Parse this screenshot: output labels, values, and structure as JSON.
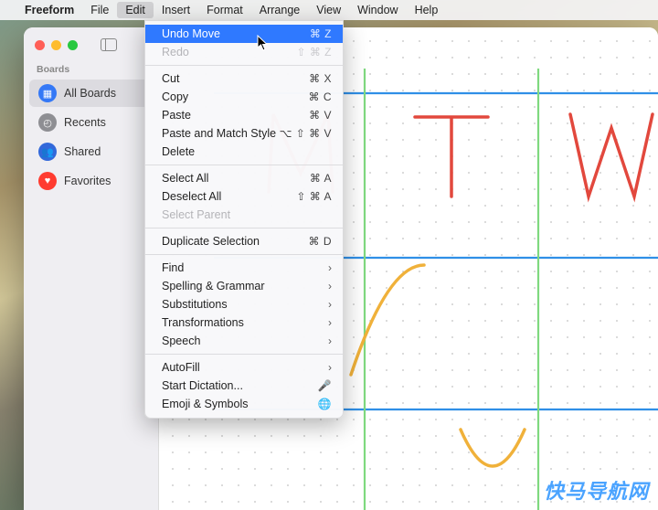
{
  "menubar": {
    "app": "Freeform",
    "items": [
      "File",
      "Edit",
      "Insert",
      "Format",
      "Arrange",
      "View",
      "Window",
      "Help"
    ],
    "open_index": 1
  },
  "sidebar": {
    "title": "Boards",
    "items": [
      {
        "label": "All Boards",
        "icon": "grid",
        "color": "blue",
        "active": true
      },
      {
        "label": "Recents",
        "icon": "clock",
        "color": "grey",
        "active": false
      },
      {
        "label": "Shared",
        "icon": "people",
        "color": "purple",
        "active": false
      },
      {
        "label": "Favorites",
        "icon": "heart",
        "color": "red",
        "active": false
      }
    ]
  },
  "edit_menu": {
    "highlight_index": 0,
    "groups": [
      [
        {
          "label": "Undo Move",
          "shortcut": "⌘ Z",
          "highlighted": true
        },
        {
          "label": "Redo",
          "shortcut": "⇧ ⌘ Z",
          "disabled": true
        }
      ],
      [
        {
          "label": "Cut",
          "shortcut": "⌘ X"
        },
        {
          "label": "Copy",
          "shortcut": "⌘ C"
        },
        {
          "label": "Paste",
          "shortcut": "⌘ V"
        },
        {
          "label": "Paste and Match Style",
          "shortcut": "⌥ ⇧ ⌘ V"
        },
        {
          "label": "Delete"
        }
      ],
      [
        {
          "label": "Select All",
          "shortcut": "⌘ A"
        },
        {
          "label": "Deselect All",
          "shortcut": "⇧ ⌘ A"
        },
        {
          "label": "Select Parent",
          "disabled": true
        }
      ],
      [
        {
          "label": "Duplicate Selection",
          "shortcut": "⌘ D"
        }
      ],
      [
        {
          "label": "Find",
          "submenu": true
        },
        {
          "label": "Spelling & Grammar",
          "submenu": true
        },
        {
          "label": "Substitutions",
          "submenu": true
        },
        {
          "label": "Transformations",
          "submenu": true
        },
        {
          "label": "Speech",
          "submenu": true
        }
      ],
      [
        {
          "label": "AutoFill",
          "submenu": true
        },
        {
          "label": "Start Dictation...",
          "shortcut": "🎤"
        },
        {
          "label": "Emoji & Symbols",
          "shortcut": "🌐"
        }
      ]
    ]
  },
  "canvas": {
    "letters": [
      "M",
      "T",
      "W"
    ],
    "ink_colors": {
      "letter": "#e2483d",
      "curve": "#f0b13a",
      "grid_h": "#2f8fe7",
      "grid_v": "#7fd97f"
    }
  },
  "watermark": "快马导航网"
}
